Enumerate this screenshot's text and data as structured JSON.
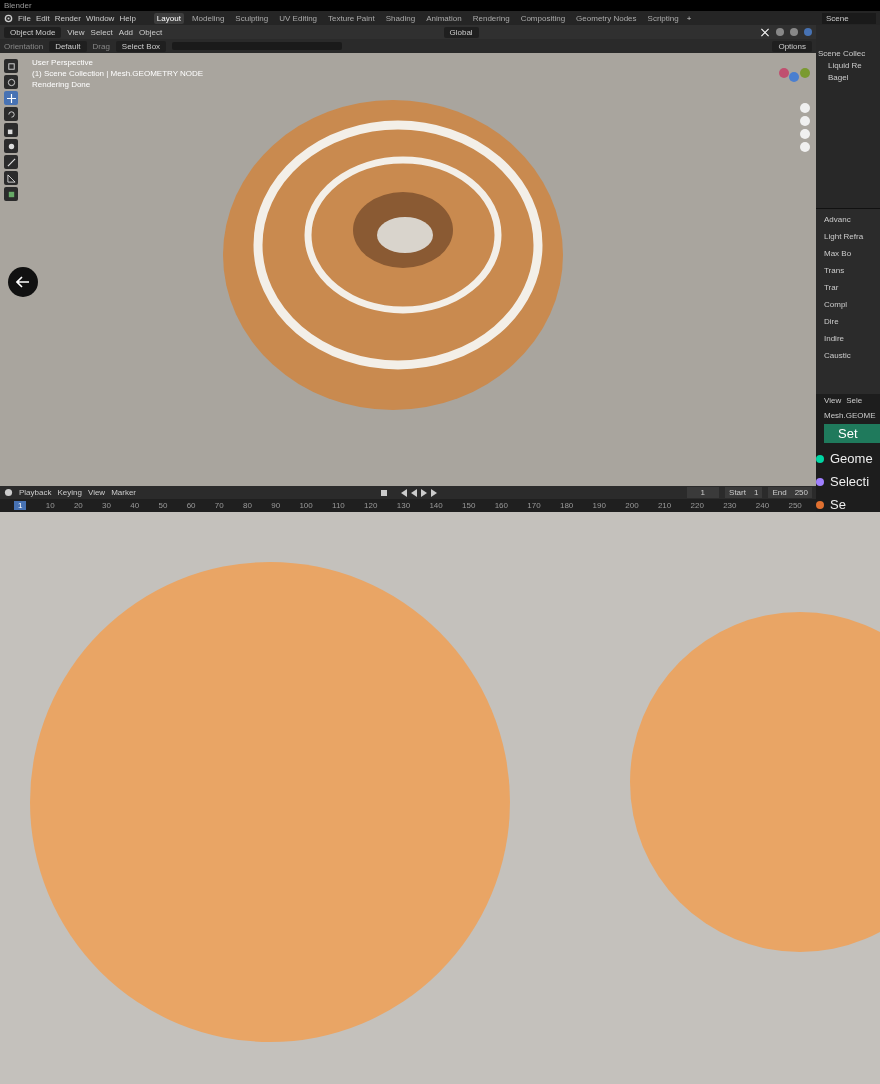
{
  "window": {
    "title": "Blender"
  },
  "menu_bar": {
    "menus": [
      "File",
      "Edit",
      "Render",
      "Window",
      "Help"
    ],
    "workspaces": [
      {
        "label": "Layout",
        "selected": true
      },
      {
        "label": "Modeling",
        "selected": false
      },
      {
        "label": "Sculpting",
        "selected": false
      },
      {
        "label": "UV Editing",
        "selected": false
      },
      {
        "label": "Texture Paint",
        "selected": false
      },
      {
        "label": "Shading",
        "selected": false
      },
      {
        "label": "Animation",
        "selected": false
      },
      {
        "label": "Rendering",
        "selected": false
      },
      {
        "label": "Compositing",
        "selected": false
      },
      {
        "label": "Geometry Nodes",
        "selected": false
      },
      {
        "label": "Scripting",
        "selected": false
      }
    ],
    "add_tab": "+",
    "scene": "Scene"
  },
  "viewport_header": {
    "mode": "Object Mode",
    "menus": [
      "View",
      "Select",
      "Add",
      "Object"
    ],
    "transform": "Global"
  },
  "tool_settings": {
    "orientation_label": "Orientation",
    "orientation": "Default",
    "drag_label": "Drag",
    "drag": "Select Box",
    "options": "Options"
  },
  "viewport": {
    "overlay_lines": [
      "User Perspective",
      "(1) Scene Collection | Mesh.GEOMETRY NODE",
      "Rendering Done"
    ],
    "tools": [
      {
        "kind": "select",
        "selected": false
      },
      {
        "kind": "cursor",
        "selected": false
      },
      {
        "kind": "move",
        "selected": true
      },
      {
        "kind": "rotate",
        "selected": false
      },
      {
        "kind": "scale",
        "selected": false
      },
      {
        "kind": "transform",
        "selected": false
      },
      {
        "kind": "annotate",
        "selected": false
      },
      {
        "kind": "measure",
        "selected": false
      },
      {
        "kind": "add",
        "selected": false
      }
    ]
  },
  "outliner": {
    "items": [
      {
        "label": "Scene Collec",
        "children": [
          {
            "label": "Liquid Re"
          },
          {
            "label": "Bagel"
          }
        ]
      }
    ]
  },
  "properties": {
    "rows": [
      "Advanc",
      "Light Refra",
      "Max Bo",
      "Trans",
      "Trar",
      "Compl",
      "Dire",
      "Indire",
      "Caustic"
    ]
  },
  "node_editor": {
    "menus": [
      "View",
      "Sele"
    ],
    "object": "Mesh.GEOME",
    "node_title": "Set",
    "sockets": [
      {
        "label": "Geome",
        "color": "#00d6a3"
      },
      {
        "label": "Selecti",
        "color": "#a080ff"
      },
      {
        "label": "Se",
        "color": "#e07030"
      }
    ]
  },
  "timeline": {
    "menus": [
      "Playback",
      "Keying",
      "View",
      "Marker"
    ],
    "current_frame": "1",
    "start_label": "Start",
    "start": "1",
    "end_label": "End",
    "end": "250",
    "ruler": [
      "1",
      "10",
      "20",
      "30",
      "40",
      "50",
      "60",
      "70",
      "80",
      "90",
      "100",
      "110",
      "120",
      "130",
      "140",
      "150",
      "160",
      "170",
      "180",
      "190",
      "200",
      "210",
      "220",
      "230",
      "240",
      "250"
    ]
  }
}
